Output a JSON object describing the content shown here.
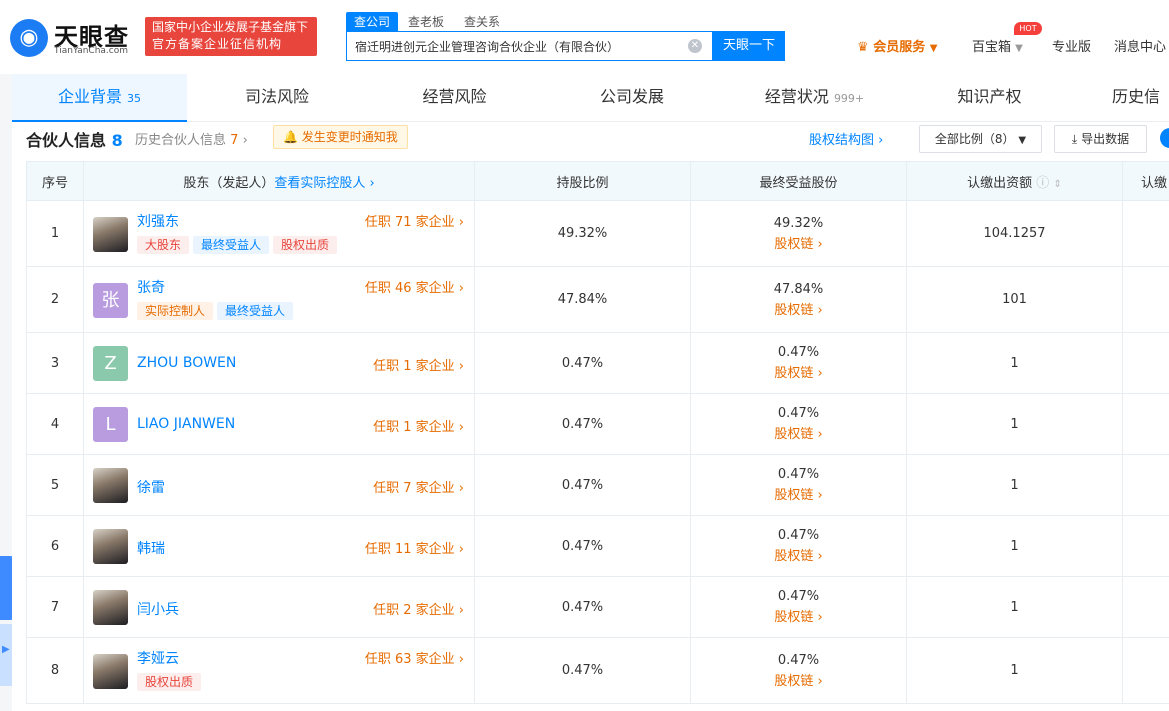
{
  "brand": {
    "cn": "天眼查",
    "en": "TianYanCha.com",
    "badge_line1": "国家中小企业发展子基金旗下",
    "badge_line2": "官方备案企业征信机构"
  },
  "search": {
    "tabs": [
      "查公司",
      "查老板",
      "查关系"
    ],
    "value": "宿迁明进创元企业管理咨询合伙企业（有限合伙）",
    "button": "天眼一下"
  },
  "nav": {
    "vip": "会员服务",
    "baibao": "百宝箱",
    "hot": "HOT",
    "pro": "专业版",
    "msg": "消息中心"
  },
  "tabs": [
    {
      "label": "企业背景",
      "count": "35"
    },
    {
      "label": "司法风险",
      "count": ""
    },
    {
      "label": "经营风险",
      "count": ""
    },
    {
      "label": "公司发展",
      "count": ""
    },
    {
      "label": "经营状况",
      "count": "999+"
    },
    {
      "label": "知识产权",
      "count": ""
    },
    {
      "label": "历史信",
      "count": ""
    }
  ],
  "section": {
    "title": "合伙人信息",
    "count": "8",
    "history_label": "历史合伙人信息",
    "history_count": "7",
    "notify": "发生变更时通知我",
    "struct_link": "股权结构图",
    "filter": "全部比例（8）",
    "export": "导出数据"
  },
  "table": {
    "headers": {
      "index": "序号",
      "shareholder": "股东（发起人）",
      "actual_link": "查看实际控股人",
      "ratio": "持股比例",
      "final": "最终受益股份",
      "capital": "认缴出资额",
      "next": "认缴"
    },
    "chain_label": "股权链",
    "rows": [
      {
        "index": "1",
        "name": "刘强东",
        "avatar_text": "",
        "avatar_color": "",
        "posts": "任职 71 家企业",
        "tags": [
          {
            "text": "大股东",
            "color": "red"
          },
          {
            "text": "最终受益人",
            "color": "blue"
          },
          {
            "text": "股权出质",
            "color": "red"
          }
        ],
        "ratio": "49.32%",
        "final": "49.32%",
        "capital": "104.1257"
      },
      {
        "index": "2",
        "name": "张奇",
        "avatar_text": "张",
        "avatar_color": "#b99ce0",
        "posts": "任职 46 家企业",
        "tags": [
          {
            "text": "实际控制人",
            "color": "orange"
          },
          {
            "text": "最终受益人",
            "color": "blue"
          }
        ],
        "ratio": "47.84%",
        "final": "47.84%",
        "capital": "101"
      },
      {
        "index": "3",
        "name": "ZHOU BOWEN",
        "avatar_text": "Z",
        "avatar_color": "#8bc9ad",
        "posts": "任职 1 家企业",
        "tags": [],
        "ratio": "0.47%",
        "final": "0.47%",
        "capital": "1"
      },
      {
        "index": "4",
        "name": "LIAO JIANWEN",
        "avatar_text": "L",
        "avatar_color": "#b99ce0",
        "posts": "任职 1 家企业",
        "tags": [],
        "ratio": "0.47%",
        "final": "0.47%",
        "capital": "1"
      },
      {
        "index": "5",
        "name": "徐雷",
        "avatar_text": "",
        "avatar_color": "",
        "posts": "任职 7 家企业",
        "tags": [],
        "ratio": "0.47%",
        "final": "0.47%",
        "capital": "1"
      },
      {
        "index": "6",
        "name": "韩瑞",
        "avatar_text": "",
        "avatar_color": "",
        "posts": "任职 11 家企业",
        "tags": [],
        "ratio": "0.47%",
        "final": "0.47%",
        "capital": "1"
      },
      {
        "index": "7",
        "name": "闫小兵",
        "avatar_text": "",
        "avatar_color": "",
        "posts": "任职 2 家企业",
        "tags": [],
        "ratio": "0.47%",
        "final": "0.47%",
        "capital": "1"
      },
      {
        "index": "8",
        "name": "李娅云",
        "avatar_text": "",
        "avatar_color": "",
        "posts": "任职 63 家企业",
        "tags": [
          {
            "text": "股权出质",
            "color": "red"
          }
        ],
        "ratio": "0.47%",
        "final": "0.47%",
        "capital": "1"
      }
    ]
  }
}
